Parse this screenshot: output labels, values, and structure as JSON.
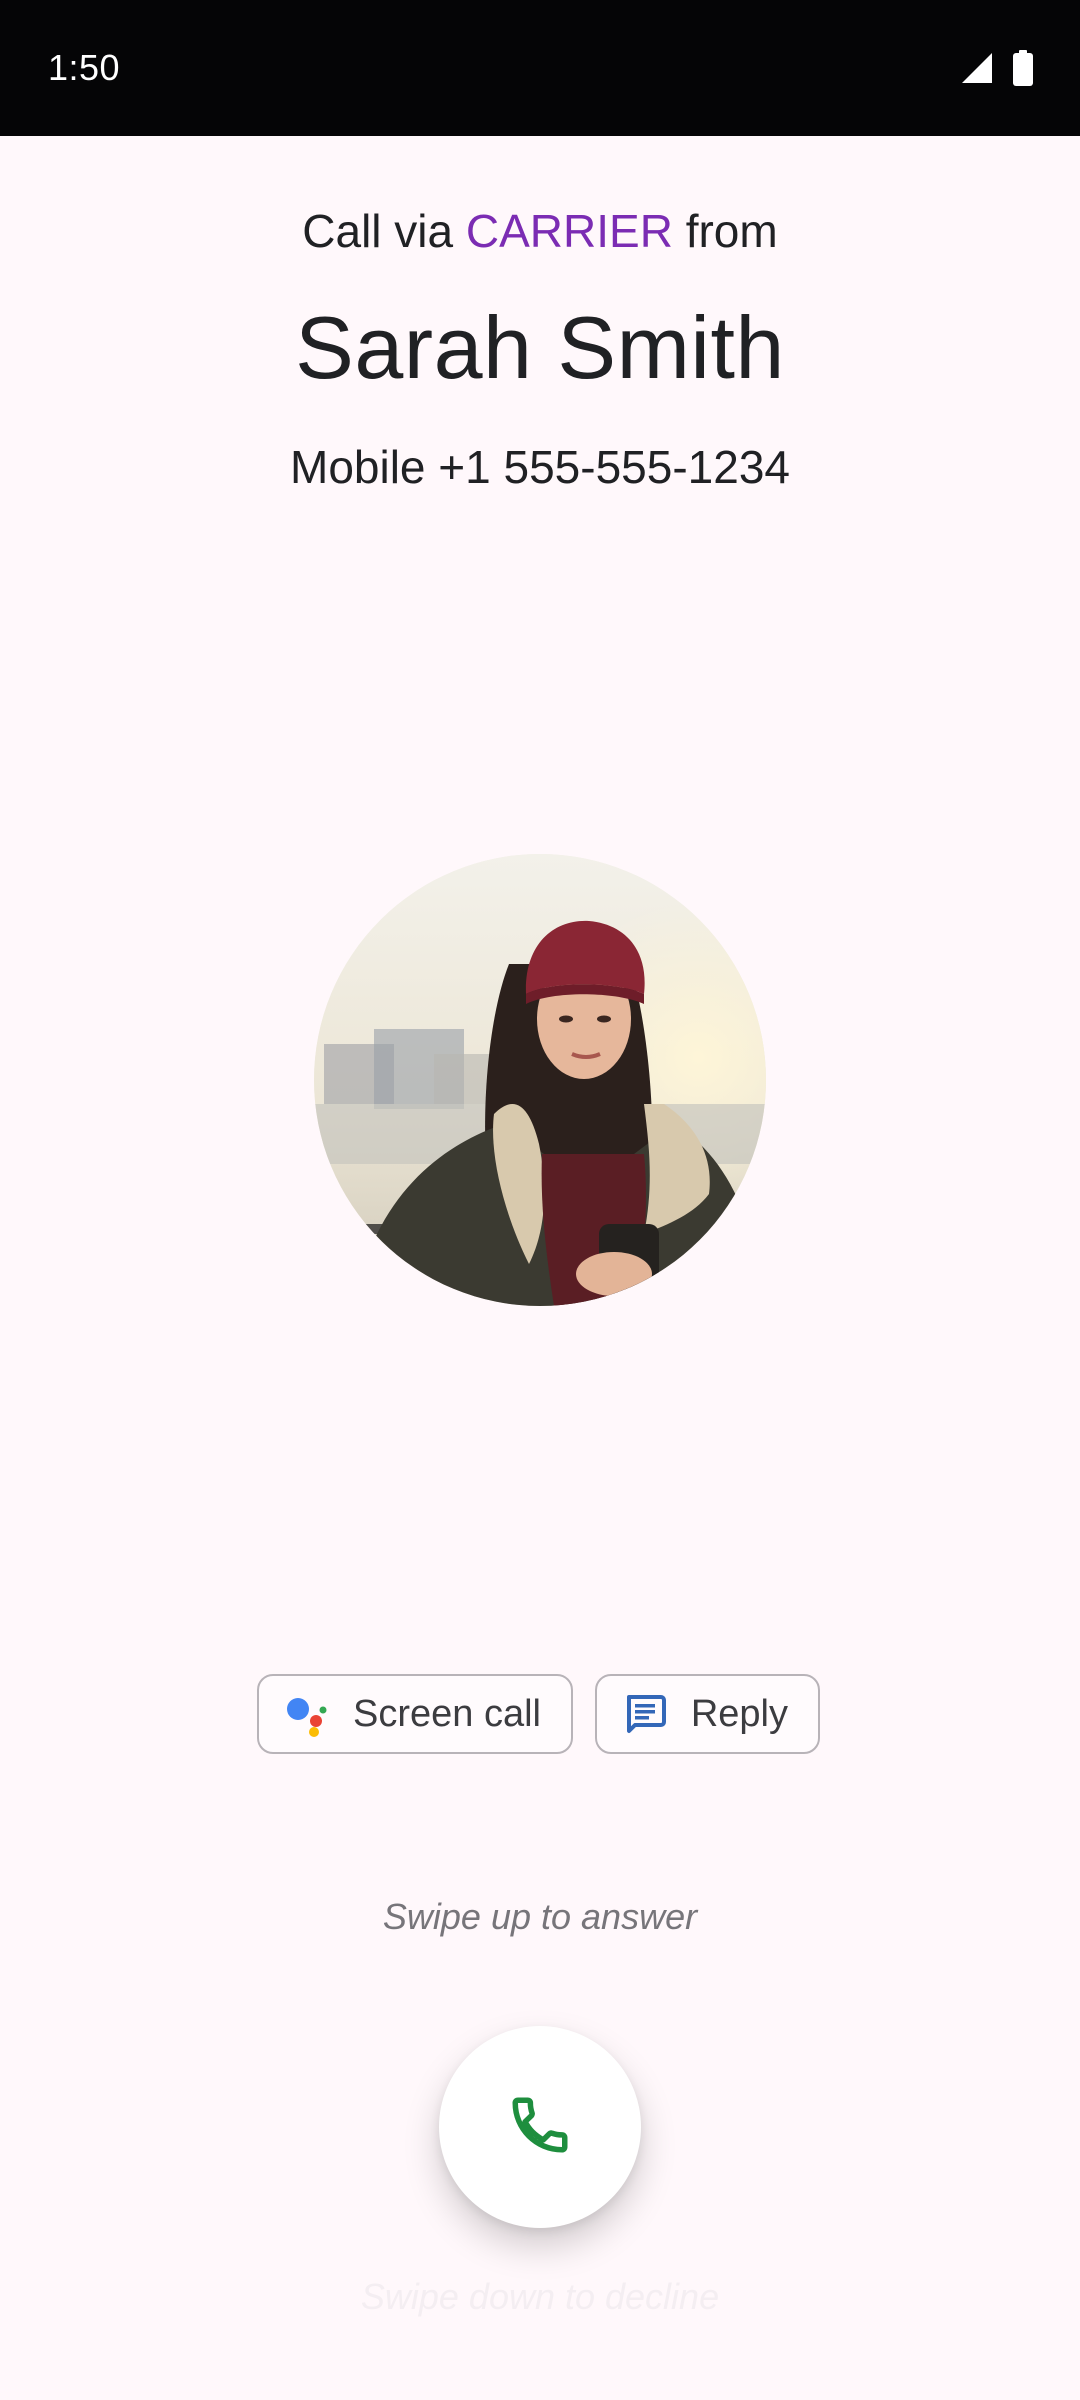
{
  "status_bar": {
    "time": "1:50",
    "icons": [
      "cell-signal-icon",
      "battery-icon"
    ]
  },
  "call": {
    "header_prefix": "Call via ",
    "carrier": "CARRIER",
    "header_suffix": " from",
    "caller_name": "Sarah Smith",
    "number_line": "Mobile +1 555-555-1234"
  },
  "actions": {
    "screen_call": {
      "label": "Screen call",
      "icon": "google-assistant-icon"
    },
    "reply": {
      "label": "Reply",
      "icon": "message-icon"
    }
  },
  "answer": {
    "hint": "Swipe up to answer",
    "button_icon": "phone-icon",
    "decline_hint": "Swipe down to decline"
  },
  "colors": {
    "carrier_accent": "#7b2cb3",
    "answer_green": "#1e8e3e",
    "background": "#fff8fb"
  }
}
